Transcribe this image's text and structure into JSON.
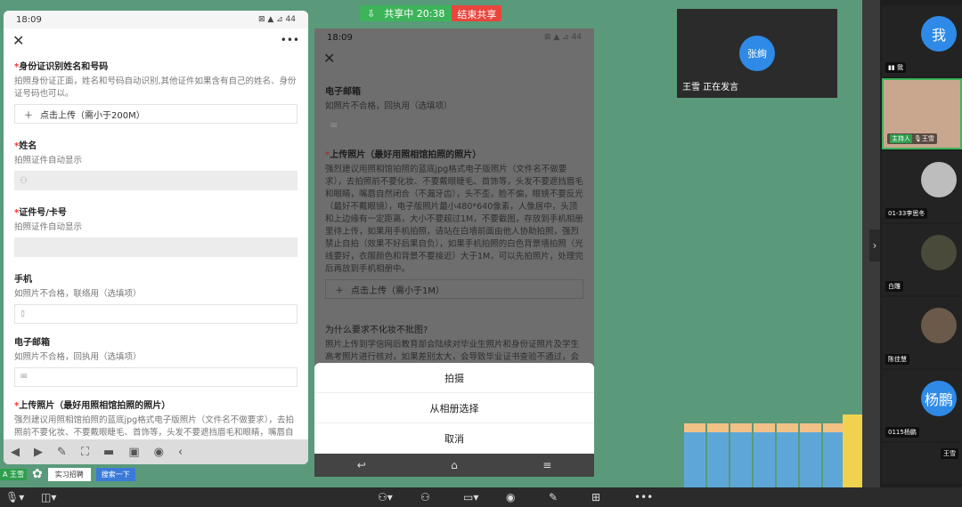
{
  "share_bar": {
    "status": "共享中 20:38",
    "stop_label": "结束共享"
  },
  "left_phone": {
    "time": "18:09",
    "status_right": "⊠ ▲ ⊿ 44",
    "menu_dots": "•••",
    "fields": [
      {
        "title": "身份证识别姓名和号码",
        "required": true,
        "desc": "拍照身份证正面，姓名和号码自动识别,其他证件如果含有自己的姓名、身份证号码也可以。",
        "upload": "点击上传（需小于200M）"
      },
      {
        "title": "姓名",
        "required": true,
        "desc": "拍照证件自动显示"
      },
      {
        "title": "证件号/卡号",
        "required": true,
        "desc": "拍照证件自动显示"
      },
      {
        "title": "手机",
        "required": false,
        "desc": "如照片不合格，联络用（选填项）"
      },
      {
        "title": "电子邮箱",
        "required": false,
        "desc": "如照片不合格，回执用（选填项）"
      },
      {
        "title": "上传照片（最好用照相馆拍照的照片）",
        "required": true,
        "desc": "强烈建议用照相馆拍照的蓝底jpg格式电子版照片（文件名不做要求），去拍照前不要化妆、不要戴眼睫毛、首饰等，头发不要遮挡眉毛和眼睛，嘴唇自然闭合（不漏牙齿），头不歪，脸不偏，眼镜不要反光（最好不戴眼镜），电子版照片最小480*640像素，人像居中，头顶和"
      }
    ]
  },
  "center_phone": {
    "time": "18:09",
    "status_right": "⊠ ▲ ⊿ 44",
    "email_title": "电子邮箱",
    "email_desc": "如照片不合格，回执用（选填项）",
    "photo_title": "上传照片（最好用照相馆拍照的照片）",
    "photo_desc": "强烈建议用照相馆拍照的蓝底jpg格式电子版照片（文件名不做要求），去拍照前不要化妆、不要戴眼睫毛、首饰等，头发不要遮挡眉毛和眼睛，嘴唇自然闭合（不漏牙齿），头不歪，脸不偏，眼镜不要反光（最好不戴眼镜），电子版照片最小480*640像素，人像居中，头顶和上边缘有一定距离，大小不要超过1M，不要截图，存放到手机相册里待上传，如果用手机拍照，请站在白墙前面由他人协助拍照，强烈禁止自拍（效果不好后果自负），如果手机拍照的白色背景墙拍照（光线要好，衣服颜色和背景不要接近）大于1M，可以先拍照片，处理完后再放到手机相册中。",
    "upload": "点击上传（需小于1M）",
    "why_title": "为什么要求不化妆不批图?",
    "why_desc": "照片上传到学信网后教育部会陆续对毕业生照片和身份证照片及学生高考照片进行核对，如果差别太大，会导致毕业证书查验不通过，会带来很大麻烦。如果实在来不及到",
    "sheet": [
      "拍摄",
      "从相册选择",
      "取消"
    ]
  },
  "speaker": {
    "avatar": "张絢",
    "label": "王雪 正在发言"
  },
  "participants": [
    {
      "avatar": "我",
      "label": "我",
      "color": "#2e8ae6",
      "host": false
    },
    {
      "avatar": "",
      "label": "王雪",
      "color": "#c9a78f",
      "host": true,
      "host_label": "主持人"
    },
    {
      "avatar": "",
      "label": "01-33李思冬",
      "color": "#bdbdbd",
      "host": false
    },
    {
      "avatar": "",
      "label": "白雕",
      "color": "#4a4a3a",
      "host": false
    },
    {
      "avatar": "",
      "label": "陈佳慧",
      "color": "#6b5a4a",
      "host": false
    },
    {
      "avatar": "杨鹏",
      "label": "0115杨鹏",
      "color": "#2e8ae6",
      "host": false
    },
    {
      "avatar": "",
      "label": "王雪",
      "color": "#333",
      "host": false
    }
  ],
  "mini_taskbar": {
    "mic": "A 王雪",
    "item": "实习招聘",
    "search": "搜索一下"
  }
}
